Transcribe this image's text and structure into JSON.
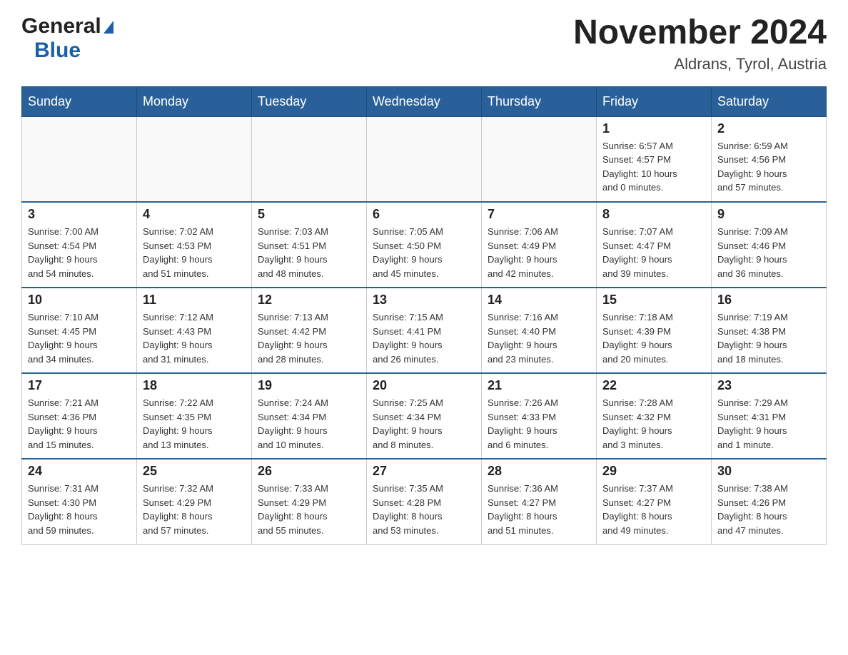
{
  "header": {
    "logo_general": "General",
    "logo_blue": "Blue",
    "month_title": "November 2024",
    "location": "Aldrans, Tyrol, Austria"
  },
  "weekdays": [
    "Sunday",
    "Monday",
    "Tuesday",
    "Wednesday",
    "Thursday",
    "Friday",
    "Saturday"
  ],
  "weeks": [
    [
      {
        "day": "",
        "info": ""
      },
      {
        "day": "",
        "info": ""
      },
      {
        "day": "",
        "info": ""
      },
      {
        "day": "",
        "info": ""
      },
      {
        "day": "",
        "info": ""
      },
      {
        "day": "1",
        "info": "Sunrise: 6:57 AM\nSunset: 4:57 PM\nDaylight: 10 hours\nand 0 minutes."
      },
      {
        "day": "2",
        "info": "Sunrise: 6:59 AM\nSunset: 4:56 PM\nDaylight: 9 hours\nand 57 minutes."
      }
    ],
    [
      {
        "day": "3",
        "info": "Sunrise: 7:00 AM\nSunset: 4:54 PM\nDaylight: 9 hours\nand 54 minutes."
      },
      {
        "day": "4",
        "info": "Sunrise: 7:02 AM\nSunset: 4:53 PM\nDaylight: 9 hours\nand 51 minutes."
      },
      {
        "day": "5",
        "info": "Sunrise: 7:03 AM\nSunset: 4:51 PM\nDaylight: 9 hours\nand 48 minutes."
      },
      {
        "day": "6",
        "info": "Sunrise: 7:05 AM\nSunset: 4:50 PM\nDaylight: 9 hours\nand 45 minutes."
      },
      {
        "day": "7",
        "info": "Sunrise: 7:06 AM\nSunset: 4:49 PM\nDaylight: 9 hours\nand 42 minutes."
      },
      {
        "day": "8",
        "info": "Sunrise: 7:07 AM\nSunset: 4:47 PM\nDaylight: 9 hours\nand 39 minutes."
      },
      {
        "day": "9",
        "info": "Sunrise: 7:09 AM\nSunset: 4:46 PM\nDaylight: 9 hours\nand 36 minutes."
      }
    ],
    [
      {
        "day": "10",
        "info": "Sunrise: 7:10 AM\nSunset: 4:45 PM\nDaylight: 9 hours\nand 34 minutes."
      },
      {
        "day": "11",
        "info": "Sunrise: 7:12 AM\nSunset: 4:43 PM\nDaylight: 9 hours\nand 31 minutes."
      },
      {
        "day": "12",
        "info": "Sunrise: 7:13 AM\nSunset: 4:42 PM\nDaylight: 9 hours\nand 28 minutes."
      },
      {
        "day": "13",
        "info": "Sunrise: 7:15 AM\nSunset: 4:41 PM\nDaylight: 9 hours\nand 26 minutes."
      },
      {
        "day": "14",
        "info": "Sunrise: 7:16 AM\nSunset: 4:40 PM\nDaylight: 9 hours\nand 23 minutes."
      },
      {
        "day": "15",
        "info": "Sunrise: 7:18 AM\nSunset: 4:39 PM\nDaylight: 9 hours\nand 20 minutes."
      },
      {
        "day": "16",
        "info": "Sunrise: 7:19 AM\nSunset: 4:38 PM\nDaylight: 9 hours\nand 18 minutes."
      }
    ],
    [
      {
        "day": "17",
        "info": "Sunrise: 7:21 AM\nSunset: 4:36 PM\nDaylight: 9 hours\nand 15 minutes."
      },
      {
        "day": "18",
        "info": "Sunrise: 7:22 AM\nSunset: 4:35 PM\nDaylight: 9 hours\nand 13 minutes."
      },
      {
        "day": "19",
        "info": "Sunrise: 7:24 AM\nSunset: 4:34 PM\nDaylight: 9 hours\nand 10 minutes."
      },
      {
        "day": "20",
        "info": "Sunrise: 7:25 AM\nSunset: 4:34 PM\nDaylight: 9 hours\nand 8 minutes."
      },
      {
        "day": "21",
        "info": "Sunrise: 7:26 AM\nSunset: 4:33 PM\nDaylight: 9 hours\nand 6 minutes."
      },
      {
        "day": "22",
        "info": "Sunrise: 7:28 AM\nSunset: 4:32 PM\nDaylight: 9 hours\nand 3 minutes."
      },
      {
        "day": "23",
        "info": "Sunrise: 7:29 AM\nSunset: 4:31 PM\nDaylight: 9 hours\nand 1 minute."
      }
    ],
    [
      {
        "day": "24",
        "info": "Sunrise: 7:31 AM\nSunset: 4:30 PM\nDaylight: 8 hours\nand 59 minutes."
      },
      {
        "day": "25",
        "info": "Sunrise: 7:32 AM\nSunset: 4:29 PM\nDaylight: 8 hours\nand 57 minutes."
      },
      {
        "day": "26",
        "info": "Sunrise: 7:33 AM\nSunset: 4:29 PM\nDaylight: 8 hours\nand 55 minutes."
      },
      {
        "day": "27",
        "info": "Sunrise: 7:35 AM\nSunset: 4:28 PM\nDaylight: 8 hours\nand 53 minutes."
      },
      {
        "day": "28",
        "info": "Sunrise: 7:36 AM\nSunset: 4:27 PM\nDaylight: 8 hours\nand 51 minutes."
      },
      {
        "day": "29",
        "info": "Sunrise: 7:37 AM\nSunset: 4:27 PM\nDaylight: 8 hours\nand 49 minutes."
      },
      {
        "day": "30",
        "info": "Sunrise: 7:38 AM\nSunset: 4:26 PM\nDaylight: 8 hours\nand 47 minutes."
      }
    ]
  ]
}
